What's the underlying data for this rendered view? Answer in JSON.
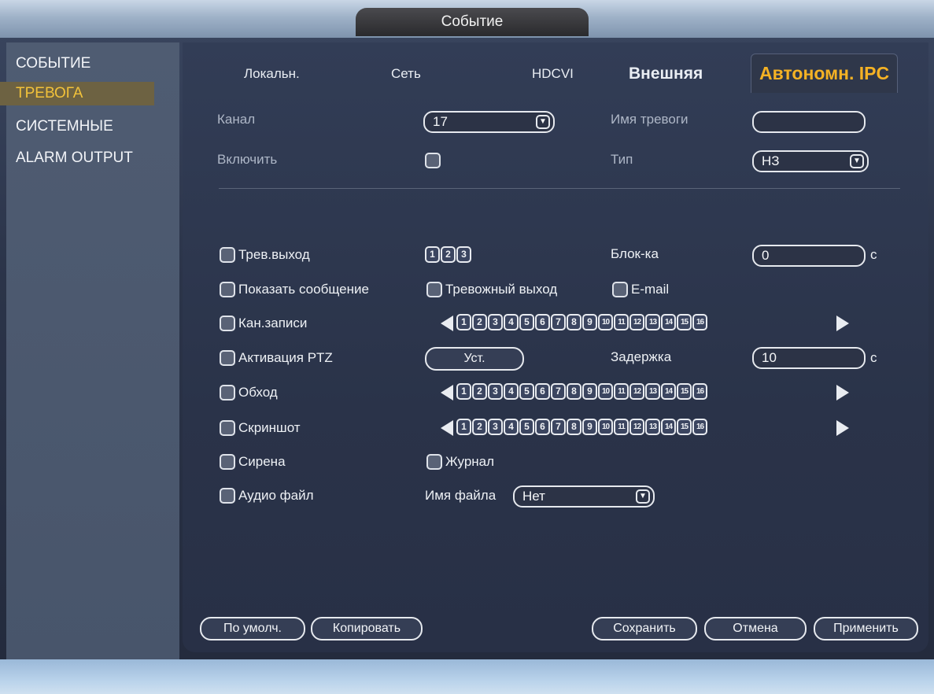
{
  "window": {
    "title": "Событие"
  },
  "sidebar": {
    "items": [
      {
        "label": "СОБЫТИЕ"
      },
      {
        "label": "ТРЕВОГА"
      },
      {
        "label": "СИСТЕМНЫЕ"
      },
      {
        "label": "ALARM OUTPUT"
      }
    ],
    "active_index": 1
  },
  "tabs": [
    {
      "label": "Локальн."
    },
    {
      "label": "Сеть"
    },
    {
      "label": "HDCVI"
    },
    {
      "label": "Внешняя"
    },
    {
      "label": "Автономн. IPC"
    }
  ],
  "active_tab": 4,
  "form": {
    "channel_label": "Канал",
    "channel_value": "17",
    "alarm_name_label": "Имя тревоги",
    "alarm_name_value": "",
    "enable_label": "Включить",
    "type_label": "Тип",
    "type_value": "НЗ",
    "alarm_out_label": "Трев.выход",
    "alarm_out_channels": [
      "1",
      "2",
      "3"
    ],
    "latch_label": "Блок-ка",
    "latch_value": "0",
    "latch_unit": "с",
    "show_message_label": "Показать сообщение",
    "alarm_upload_label": "Тревожный выход",
    "email_label": "E-mail",
    "record_channel_label": "Кан.записи",
    "ptz_label": "Активация PTZ",
    "ptz_button": "Уст.",
    "delay_label": "Задержка",
    "delay_value": "10",
    "delay_unit": "с",
    "tour_label": "Обход",
    "snapshot_label": "Скриншот",
    "siren_label": "Сирена",
    "log_label": "Журнал",
    "audio_label": "Аудио файл",
    "file_name_label": "Имя файла",
    "file_name_value": "Нет",
    "channel_numbers": [
      "1",
      "2",
      "3",
      "4",
      "5",
      "6",
      "7",
      "8",
      "9",
      "10",
      "11",
      "12",
      "13",
      "14",
      "15",
      "16"
    ]
  },
  "buttons": {
    "default": "По умолч.",
    "copy": "Копировать",
    "save": "Сохранить",
    "cancel": "Отмена",
    "apply": "Применить"
  },
  "colors": {
    "active_tab": "#f5b224",
    "active_sidebar": "#f2c23a"
  }
}
